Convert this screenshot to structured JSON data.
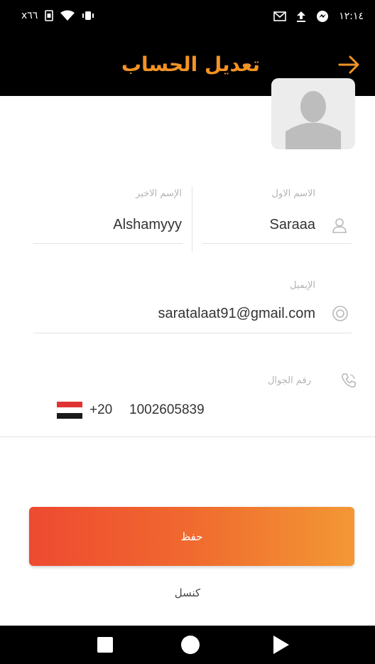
{
  "status_bar": {
    "left_text": "x٦٦",
    "time": "١٢:١٤",
    "icons_left": [
      "sim-icon",
      "wifi-icon",
      "vibrate-icon"
    ],
    "icons_right": [
      "gmail-icon",
      "upload-icon",
      "messenger-icon"
    ]
  },
  "header": {
    "title": "تعديل الحساب",
    "background": "#000000",
    "title_color": "#f39323"
  },
  "form": {
    "first_name": {
      "label": "الاسم الاول",
      "value": "Saraaa"
    },
    "last_name": {
      "label": "الإسم الاخير",
      "value": "Alshamyyy"
    },
    "email": {
      "label": "الإيميل",
      "value": "saratalaat91@gmail.com"
    },
    "phone": {
      "label": "رقم الجوال",
      "country_code": "+20",
      "number": "1002605839"
    }
  },
  "actions": {
    "save_label": "حفظ",
    "cancel_label": "كنسل",
    "save_gradient": [
      "#ee4a30",
      "#f39834"
    ]
  }
}
